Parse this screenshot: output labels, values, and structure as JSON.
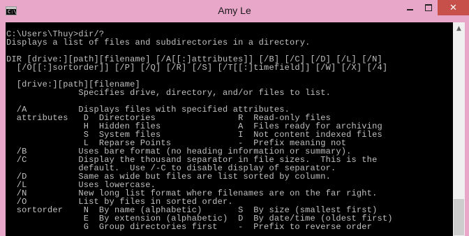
{
  "window": {
    "title": "Amy Le",
    "icon_text": "C:\\",
    "minimize_icon": "minimize-icon",
    "maximize_icon": "maximize-icon",
    "close_icon": "close-icon",
    "close_glyph": "✕"
  },
  "scrollbar": {
    "up_glyph": "▲"
  },
  "console": {
    "lines": [
      "C:\\Users\\Thuy>dir/?",
      "Displays a list of files and subdirectories in a directory.",
      "",
      "DIR [drive:][path][filename] [/A[[:]attributes]] [/B] [/C] [/D] [/L] [/N]",
      "  [/O[[:]sortorder]] [/P] [/Q] [/R] [/S] [/T[[:]timefield]] [/W] [/X] [/4]",
      "",
      "  [drive:][path][filename]",
      "              Specifies drive, directory, and/or files to list.",
      "",
      "  /A          Displays files with specified attributes.",
      "  attributes   D  Directories                R  Read-only files",
      "               H  Hidden files               A  Files ready for archiving",
      "               S  System files               I  Not content indexed files",
      "               L  Reparse Points             -  Prefix meaning not",
      "  /B          Uses bare format (no heading information or summary).",
      "  /C          Display the thousand separator in file sizes.  This is the",
      "              default.  Use /-C to disable display of separator.",
      "  /D          Same as wide but files are list sorted by column.",
      "  /L          Uses lowercase.",
      "  /N          New long list format where filenames are on the far right.",
      "  /O          List by files in sorted order.",
      "  sortorder    N  By name (alphabetic)       S  By size (smallest first)",
      "               E  By extension (alphabetic)  D  By date/time (oldest first)",
      "               G  Group directories first    -  Prefix to reverse order"
    ]
  }
}
